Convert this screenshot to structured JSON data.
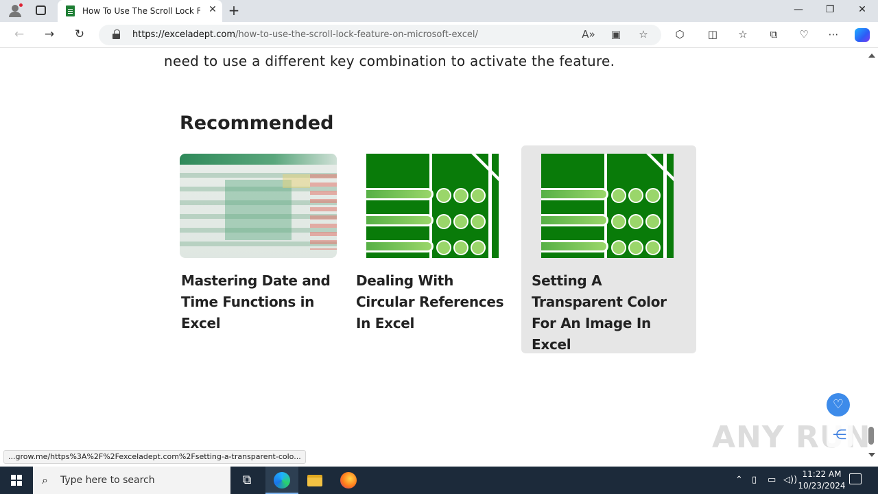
{
  "browser": {
    "tab_title": "How To Use The Scroll Lock Feature On Microsoft Excel",
    "new_tab_symbol": "+",
    "url_domain": "https://exceladept.com",
    "url_path": "/how-to-use-the-scroll-lock-feature-on-microsoft-excel/",
    "status_url": "...grow.me/https%3A%2F%2Fexceladept.com%2Fsetting-a-transparent-colo..."
  },
  "page": {
    "lead_text": "need to use a different key combination to activate the feature.",
    "recommended_heading": "Recommended",
    "cards": [
      {
        "title": "Mastering Date and Time Functions in Excel"
      },
      {
        "title": "Dealing With Circular References In Excel"
      },
      {
        "title": "Setting A Transparent Color For An Image In Excel"
      }
    ],
    "watermark": "ANY RUN"
  },
  "taskbar": {
    "search_placeholder": "Type here to search",
    "time": "11:22 AM",
    "date": "10/23/2024"
  },
  "colors": {
    "excel_green": "#097b09",
    "accent_blue": "#3d8bea",
    "hover_card": "#e6e6e6"
  }
}
